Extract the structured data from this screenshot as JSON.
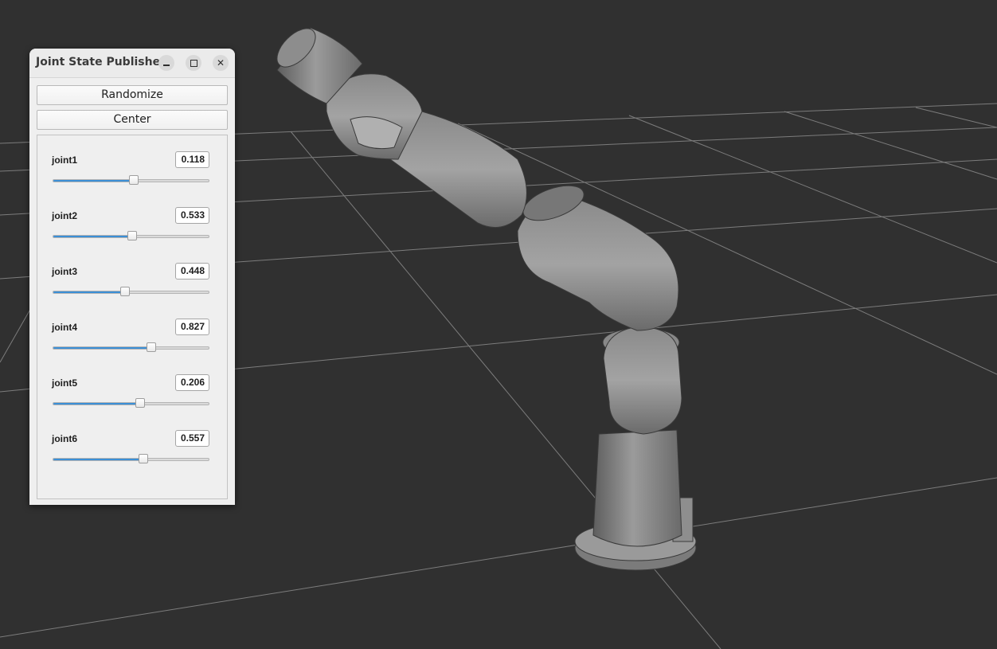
{
  "window": {
    "title": "Joint State Publisher",
    "controls": {
      "minimize_icon": "minimize-icon",
      "maximize_icon": "maximize-icon",
      "close_icon": "close-icon"
    }
  },
  "buttons": {
    "randomize": "Randomize",
    "center": "Center"
  },
  "joints": [
    {
      "name": "joint1",
      "value": "0.118",
      "slider_fraction": 0.52
    },
    {
      "name": "joint2",
      "value": "0.533",
      "slider_fraction": 0.51
    },
    {
      "name": "joint3",
      "value": "0.448",
      "slider_fraction": 0.46
    },
    {
      "name": "joint4",
      "value": "0.827",
      "slider_fraction": 0.63
    },
    {
      "name": "joint5",
      "value": "0.206",
      "slider_fraction": 0.56
    },
    {
      "name": "joint6",
      "value": "0.557",
      "slider_fraction": 0.58
    }
  ],
  "colors": {
    "viewport_bg": "#303030",
    "slider_accent": "#3b8fd6"
  }
}
